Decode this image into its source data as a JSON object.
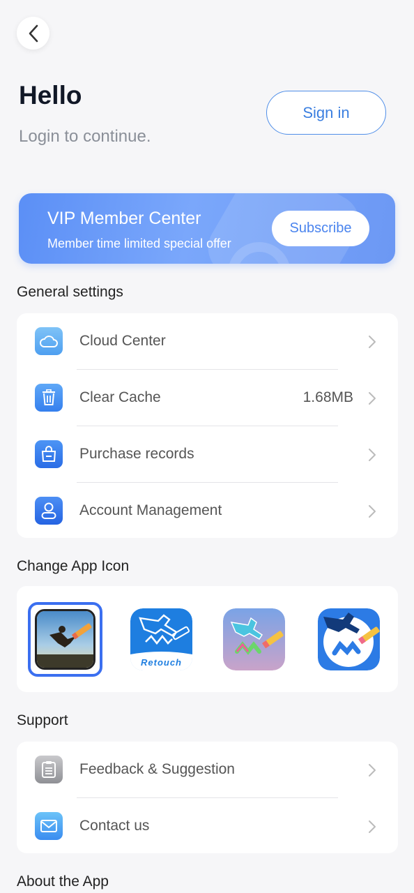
{
  "header": {
    "back_icon": "chevron-left-icon",
    "greeting": "Hello",
    "subtitle": "Login to continue.",
    "sign_in_label": "Sign in"
  },
  "vip": {
    "title": "VIP Member Center",
    "subtitle": "Member time limited special offer",
    "subscribe_label": "Subscribe"
  },
  "general": {
    "title": "General settings",
    "items": [
      {
        "label": "Cloud Center",
        "value": "",
        "icon": "cloud-icon"
      },
      {
        "label": "Clear Cache",
        "value": "1.68MB",
        "icon": "trash-icon"
      },
      {
        "label": "Purchase records",
        "value": "",
        "icon": "shopping-bag-icon"
      },
      {
        "label": "Account Management",
        "value": "",
        "icon": "user-card-icon"
      }
    ]
  },
  "app_icons": {
    "title": "Change App Icon",
    "options": [
      {
        "name": "photo-jump-icon",
        "selected": true
      },
      {
        "name": "retouch-icon",
        "text": "Retouch",
        "selected": false
      },
      {
        "name": "colorful-figure-icon",
        "selected": false
      },
      {
        "name": "blue-figure-icon",
        "selected": false
      }
    ]
  },
  "support": {
    "title": "Support",
    "items": [
      {
        "label": "Feedback & Suggestion",
        "icon": "clipboard-icon"
      },
      {
        "label": "Contact us",
        "icon": "mail-icon"
      }
    ]
  },
  "about": {
    "title": "About the App"
  },
  "colors": {
    "accent": "#3b7fe0",
    "vip_gradient_start": "#5b8ff6",
    "background": "#f6f6f8"
  }
}
